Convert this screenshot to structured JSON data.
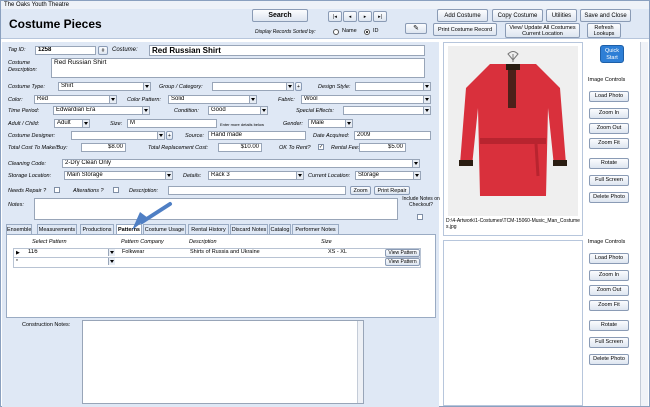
{
  "window": {
    "title": "The Oaks Youth Theatre"
  },
  "header": {
    "form_title": "Costume Pieces",
    "search_label": "Search",
    "sort_label": "Display Records Sorted by:",
    "sort_name": "Name",
    "sort_id": "ID",
    "nav_first": "|◂",
    "nav_prev": "◂",
    "nav_next": "▸",
    "nav_last": "▸|",
    "add_costume": "Add Costume",
    "copy_costume": "Copy Costume",
    "utilities": "Utilities",
    "save_close": "Save and Close",
    "print_record": "Print Costume Record",
    "view_update": "View/ Update All Costumes Current Location",
    "refresh": "Refresh Lookups"
  },
  "form": {
    "tag_id_label": "Tag ID:",
    "tag_id": "1258",
    "hash": "#",
    "costume_label": "Costume:",
    "costume": "Red Russian Shirt",
    "desc_label": "Costume Description:",
    "desc": "Red Russian Shirt",
    "type_label": "Costume Type:",
    "type": "Shirt",
    "group_label": "Group / Category:",
    "group": "",
    "design_label": "Design Style:",
    "design": "",
    "color_label": "Color:",
    "color": "Red",
    "pattern_label": "Color Pattern:",
    "pattern": "Solid",
    "fabric_label": "Fabric:",
    "fabric": "Wool",
    "period_label": "Time Period:",
    "period": "Edwardian Era",
    "condition_label": "Condition:",
    "condition": "Good",
    "effects_label": "Special Effects:",
    "effects": "",
    "adult_label": "Adult / Child:",
    "adult": "Adult",
    "size_label": "Size:",
    "size": "M",
    "size_hint": "Enter more details below",
    "gender_label": "Gender:",
    "gender": "Male",
    "designer_label": "Costume Designer:",
    "designer": "",
    "source_label": "Source:",
    "source": "Hand made",
    "acquired_label": "Date Acquired:",
    "acquired": "2009",
    "total_make_label": "Total Cost To Make/Buy:",
    "total_make": "$8.00",
    "replace_label": "Total Replacement Cost:",
    "replace": "$10.00",
    "ok_rent_label": "OK To Rent?",
    "rental_fee_label": "Rental Fee:",
    "rental_fee": "$5.00",
    "cleaning_label": "Cleaning Code:",
    "cleaning": "2-Dry Clean Only",
    "storage_label": "Storage Location:",
    "storage": "Main Storage",
    "details_label": "Details:",
    "details": "Rack 3",
    "current_label": "Current Location:",
    "current": "Storage",
    "repair_label": "Needs Repair ?",
    "alter_label": "Alterations ?",
    "description_label": "Description:",
    "zoom": "Zoom",
    "print_repair": "Print Repair",
    "notes_label": "Notes:",
    "include_notes": "Include Notes on Checkout?"
  },
  "tabs": [
    {
      "label": "Ensemble"
    },
    {
      "label": "Measurements"
    },
    {
      "label": "Productions"
    },
    {
      "label": "Patterns"
    },
    {
      "label": "Costume Usage"
    },
    {
      "label": "Rental History"
    },
    {
      "label": "Discard Notes"
    },
    {
      "label": "Catalog"
    },
    {
      "label": "Performer Notes"
    }
  ],
  "patterns": {
    "headers": {
      "select": "Select Pattern",
      "company": "Pattern Company",
      "description": "Description",
      "size": "Size"
    },
    "rows": [
      {
        "pattern": "116",
        "company": "Folkwear",
        "description": "Shirts of Russia and Ukraine",
        "size": "XS - XL",
        "view": "View Pattern"
      },
      {
        "pattern": "",
        "company": "",
        "description": "",
        "size": "",
        "view": "View Pattern"
      }
    ],
    "construction_label": "Construction Notes:"
  },
  "image": {
    "path": "D:\\4-Artwork\\1-Costumes\\TCM-15060-Music_Man_Costumes.jpg",
    "quick_start": "Quick Start",
    "controls_label": "Image Controls",
    "controls": [
      "Load Photo",
      "Zoom In",
      "Zoom Out",
      "Zoom Fit",
      "Rotate",
      "Full Screen",
      "Delete Photo"
    ],
    "controls2": [
      "Load Photo",
      "Zoom In",
      "Zoom Out",
      "Zoom Fit",
      "Rotate",
      "Full Screen",
      "Delete Photo"
    ]
  }
}
